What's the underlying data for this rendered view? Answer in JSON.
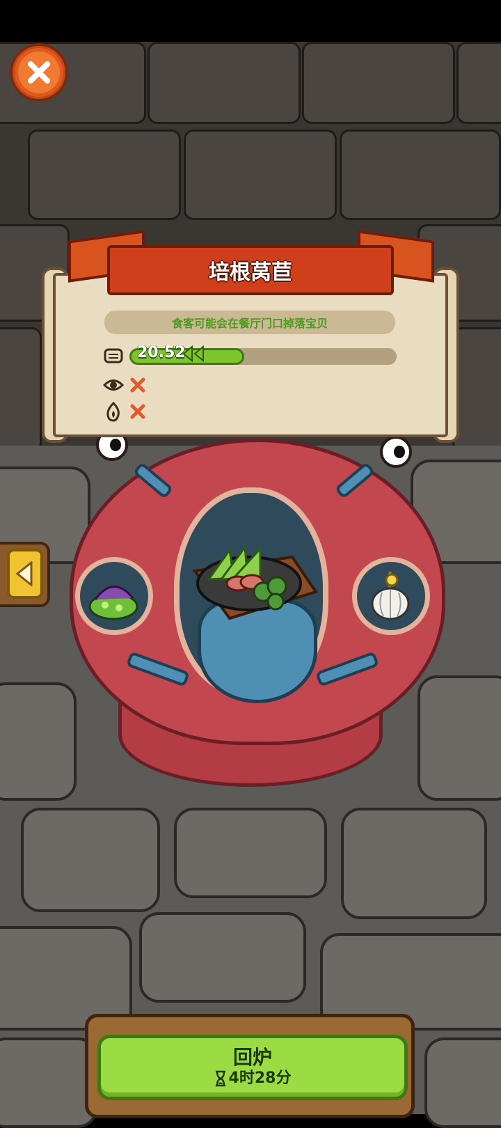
{
  "dish": {
    "title": "培根莴苣",
    "description": "食客可能会在餐厅门口掉落宝贝",
    "progress": {
      "value_text": "20.52",
      "fill_fraction": 0.43
    },
    "stats": [
      {
        "icon": "table-icon",
        "kind": "progress"
      },
      {
        "icon": "eye-icon",
        "status": "unavailable"
      },
      {
        "icon": "flame-icon",
        "status": "unavailable"
      }
    ]
  },
  "ingredients": {
    "left": "purple-mushroom-bowl-icon",
    "center": "bacon-lettuce-sizzling-plate",
    "right": "garlic-icon"
  },
  "action": {
    "label": "回炉",
    "timer": "4时28分",
    "timer_icon": "hourglass-icon"
  },
  "colors": {
    "accent_green": "#9bdc45",
    "banner_red": "#cf3f1c",
    "monster_red": "#c2474f"
  }
}
